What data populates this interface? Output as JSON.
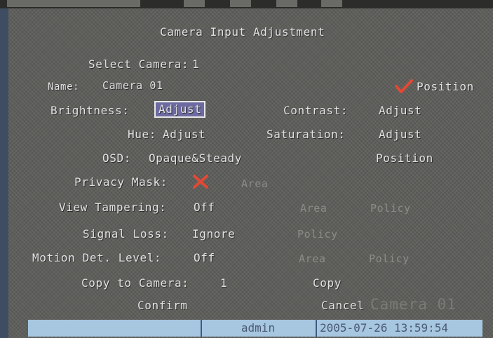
{
  "title": "Camera Input Adjustment",
  "select_camera": {
    "label": "Select Camera:",
    "value": "1"
  },
  "name": {
    "label": "Name:",
    "value": "Camera 01"
  },
  "position_top": "Position",
  "brightness": {
    "label": "Brightness:",
    "action": "Adjust"
  },
  "contrast": {
    "label": "Contrast:",
    "action": "Adjust"
  },
  "hue": {
    "label": "Hue:",
    "action": "Adjust"
  },
  "saturation": {
    "label": "Saturation:",
    "action": "Adjust"
  },
  "osd": {
    "label": "OSD:",
    "value": "Opaque&Steady",
    "position": "Position"
  },
  "privacy_mask": {
    "label": "Privacy Mask:",
    "area": "Area"
  },
  "view_tampering": {
    "label": "View Tampering:",
    "value": "Off",
    "area": "Area",
    "policy": "Policy"
  },
  "signal_loss": {
    "label": "Signal Loss:",
    "value": "Ignore",
    "policy": "Policy"
  },
  "motion_det": {
    "label": "Motion Det. Level:",
    "value": "Off",
    "area": "Area",
    "policy": "Policy"
  },
  "copy_to_camera": {
    "label": "Copy to Camera:",
    "value": "1",
    "copy": "Copy"
  },
  "confirm": "Confirm",
  "cancel": "Cancel",
  "osd_overlay": "Camera 01",
  "status_bar": {
    "user": "admin",
    "datetime": "2005-07-26 13:59:54"
  },
  "colors": {
    "background": "#5c5c59",
    "status_bar": "#a7c6e0",
    "check": "#e04a35",
    "selection": "#6c6aa0"
  },
  "icons": {
    "position_enabled": "checkmark-icon",
    "privacy_mask_disabled": "cross-icon"
  }
}
